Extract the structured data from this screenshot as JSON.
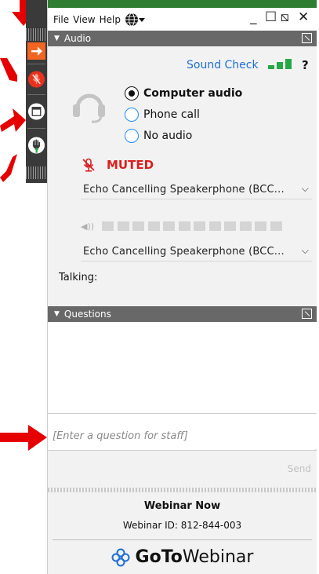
{
  "menu": {
    "file": "File",
    "view": "View",
    "help": "Help"
  },
  "icons": {
    "globe": "globe-icon",
    "minimize": "minimize-icon",
    "maximize": "maximize-icon",
    "popout": "popout-icon",
    "close": "close-icon",
    "exit_arrow": "exit-arrow-icon",
    "mic_muted": "microphone-muted-icon",
    "screen": "screen-icon",
    "raise_hand": "raise-hand-icon",
    "headset": "headset-icon",
    "speaker": "speaker-icon",
    "chevron": "chevron-down-icon"
  },
  "window": {
    "minimize": "_",
    "maximize": "☐",
    "popout": "⧅",
    "close": "✕"
  },
  "audio": {
    "header": "Audio",
    "sound_check": "Sound Check",
    "help": "?",
    "options": [
      {
        "label": "Computer audio",
        "selected": true
      },
      {
        "label": "Phone call",
        "selected": false
      },
      {
        "label": "No audio",
        "selected": false
      }
    ],
    "muted_label": "MUTED",
    "microphone": "Echo Cancelling Speakerphone (BCC...",
    "speaker": "Echo Cancelling Speakerphone (BCC...",
    "talking_label": "Talking:"
  },
  "questions": {
    "header": "Questions",
    "placeholder": "[Enter a question for staff]",
    "send_label": "Send"
  },
  "footer": {
    "title": "Webinar Now",
    "webinar_id": "Webinar ID: 812-844-003",
    "brand_bold": "GoTo",
    "brand_light": "Webinar"
  },
  "colors": {
    "accent_blue": "#1e6fd6",
    "muted_red": "#d9201f",
    "header_gray": "#686868",
    "level_green": "#28a745",
    "arrow_red": "#e60000",
    "exit_orange": "#f26522"
  }
}
